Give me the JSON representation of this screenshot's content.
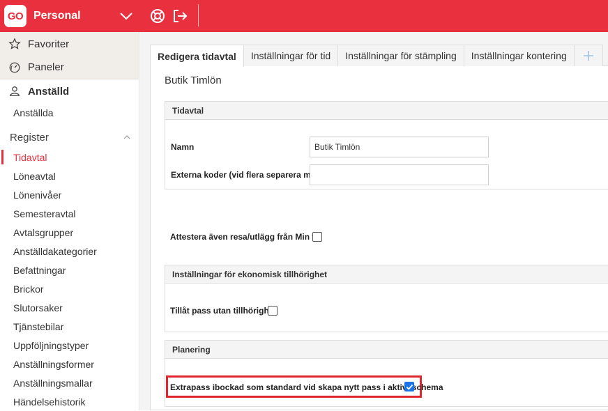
{
  "topbar": {
    "logo_text": "GO",
    "app_name": "Personal",
    "icons": [
      "chevron-down-icon",
      "lifebuoy-icon",
      "logout-icon"
    ],
    "bg_color": "#e8303f"
  },
  "sidebar": {
    "top_items": [
      {
        "label": "Favoriter",
        "icon": "star-icon"
      },
      {
        "label": "Paneler",
        "icon": "gauge-icon"
      }
    ],
    "section_header": {
      "label": "Anställd",
      "icon": "user-icon"
    },
    "section_items": [
      {
        "label": "Anställda"
      }
    ],
    "register": {
      "label": "Register",
      "items": [
        {
          "label": "Tidavtal",
          "active": true
        },
        {
          "label": "Löneavtal"
        },
        {
          "label": "Lönenivåer"
        },
        {
          "label": "Semesteravtal"
        },
        {
          "label": "Avtalsgrupper"
        },
        {
          "label": "Anställdakategorier"
        },
        {
          "label": "Befattningar"
        },
        {
          "label": "Brickor"
        },
        {
          "label": "Slutorsaker"
        },
        {
          "label": "Tjänstebilar"
        },
        {
          "label": "Uppföljningstyper"
        },
        {
          "label": "Anställningsformer"
        },
        {
          "label": "Anställningsmallar"
        },
        {
          "label": "Händelsehistorik"
        }
      ]
    }
  },
  "tabs": [
    {
      "label": "Redigera tidavtal",
      "active": true
    },
    {
      "label": "Inställningar för tid"
    },
    {
      "label": "Inställningar för stämpling"
    },
    {
      "label": "Inställningar kontering"
    }
  ],
  "page_title": "Butik Timlön",
  "sections": {
    "tidavtal": {
      "header": "Tidavtal",
      "name_label": "Namn",
      "name_value": "Butik Timlön",
      "codes_label": "Externa koder (vid flera separera med #)",
      "codes_value": "",
      "attest_label": "Attestera även resa/utlägg från Min tid",
      "attest_checked": false
    },
    "ekonomisk": {
      "header": "Inställningar för ekonomisk tillhörighet",
      "allow_label": "Tillåt pass utan tillhörighet",
      "allow_checked": false
    },
    "planering": {
      "header": "Planering",
      "extrapass_label": "Extrapass ibockad som standard vid skapa nytt pass i aktivt schema",
      "extrapass_checked": true
    }
  },
  "colors": {
    "accent": "#e8303f",
    "checkbox_checked": "#1a73e8",
    "highlight_border": "#e0262f"
  }
}
